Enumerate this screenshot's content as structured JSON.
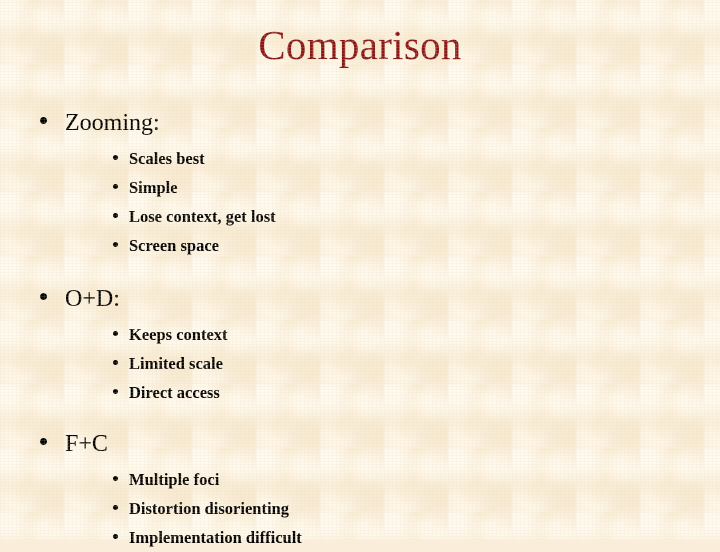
{
  "slide": {
    "title": "Comparison",
    "title_color": "#8a1616",
    "background_color": "#faeedb",
    "text_color": "#000000",
    "sections": [
      {
        "heading": "Zooming:",
        "points": [
          "Scales best",
          "Simple",
          "Lose context, get lost",
          "Screen space"
        ]
      },
      {
        "heading": "O+D:",
        "points": [
          "Keeps context",
          "Limited scale",
          "Direct access"
        ]
      },
      {
        "heading": "F+C",
        "points": [
          "Multiple foci",
          "Distortion disorienting",
          "Implementation difficult"
        ]
      }
    ]
  }
}
